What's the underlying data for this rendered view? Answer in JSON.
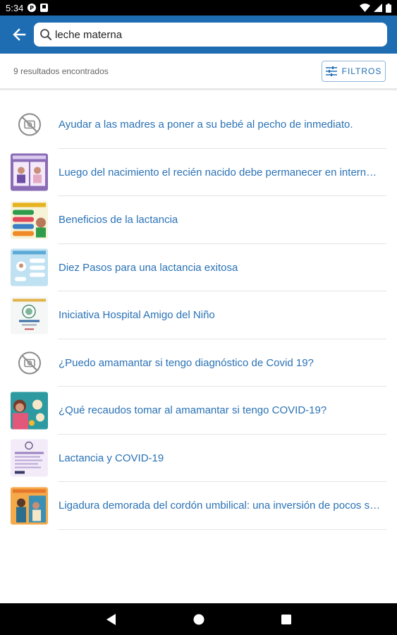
{
  "status_bar": {
    "time": "5:34",
    "left_icons": [
      "p-icon",
      "notification-icon"
    ],
    "right_icons": [
      "wifi-icon",
      "signal-icon",
      "battery-icon"
    ]
  },
  "app_bar": {
    "background_color": "#1e6db3",
    "back_icon": "arrow-left-icon",
    "search": {
      "value": "leche materna",
      "placeholder": ""
    }
  },
  "results": {
    "count_text": "9 resultados encontrados",
    "filters_label": "FILTROS",
    "filters_icon": "sliders-icon",
    "items": [
      {
        "label": "Ayudar a las madres a poner a su bebé al pecho de inmediato.",
        "thumbnail": "no-image-icon"
      },
      {
        "label": "Luego del nacimiento el recién nacido debe permanecer en internación conjunta con su madre",
        "thumbnail": "infographic-purple"
      },
      {
        "label": "Beneficios de la lactancia",
        "thumbnail": "infographic-green"
      },
      {
        "label": "Diez Pasos para una lactancia exitosa",
        "thumbnail": "infographic-lightblue"
      },
      {
        "label": "Iniciativa Hospital Amigo del Niño",
        "thumbnail": "infographic-logo"
      },
      {
        "label": "¿Puedo amamantar si tengo diagnóstico de Covid 19?",
        "thumbnail": "no-image-icon"
      },
      {
        "label": "¿Qué recaudos tomar al amamantar si tengo COVID-19?",
        "thumbnail": "infographic-teal"
      },
      {
        "label": "Lactancia y COVID-19",
        "thumbnail": "infographic-lilac"
      },
      {
        "label": "Ligadura demorada del cordón umbilical: una inversión de pocos segundos",
        "thumbnail": "infographic-orange"
      }
    ]
  },
  "nav_bar": {
    "buttons": [
      "back-triangle-icon",
      "home-circle-icon",
      "recents-square-icon"
    ]
  }
}
